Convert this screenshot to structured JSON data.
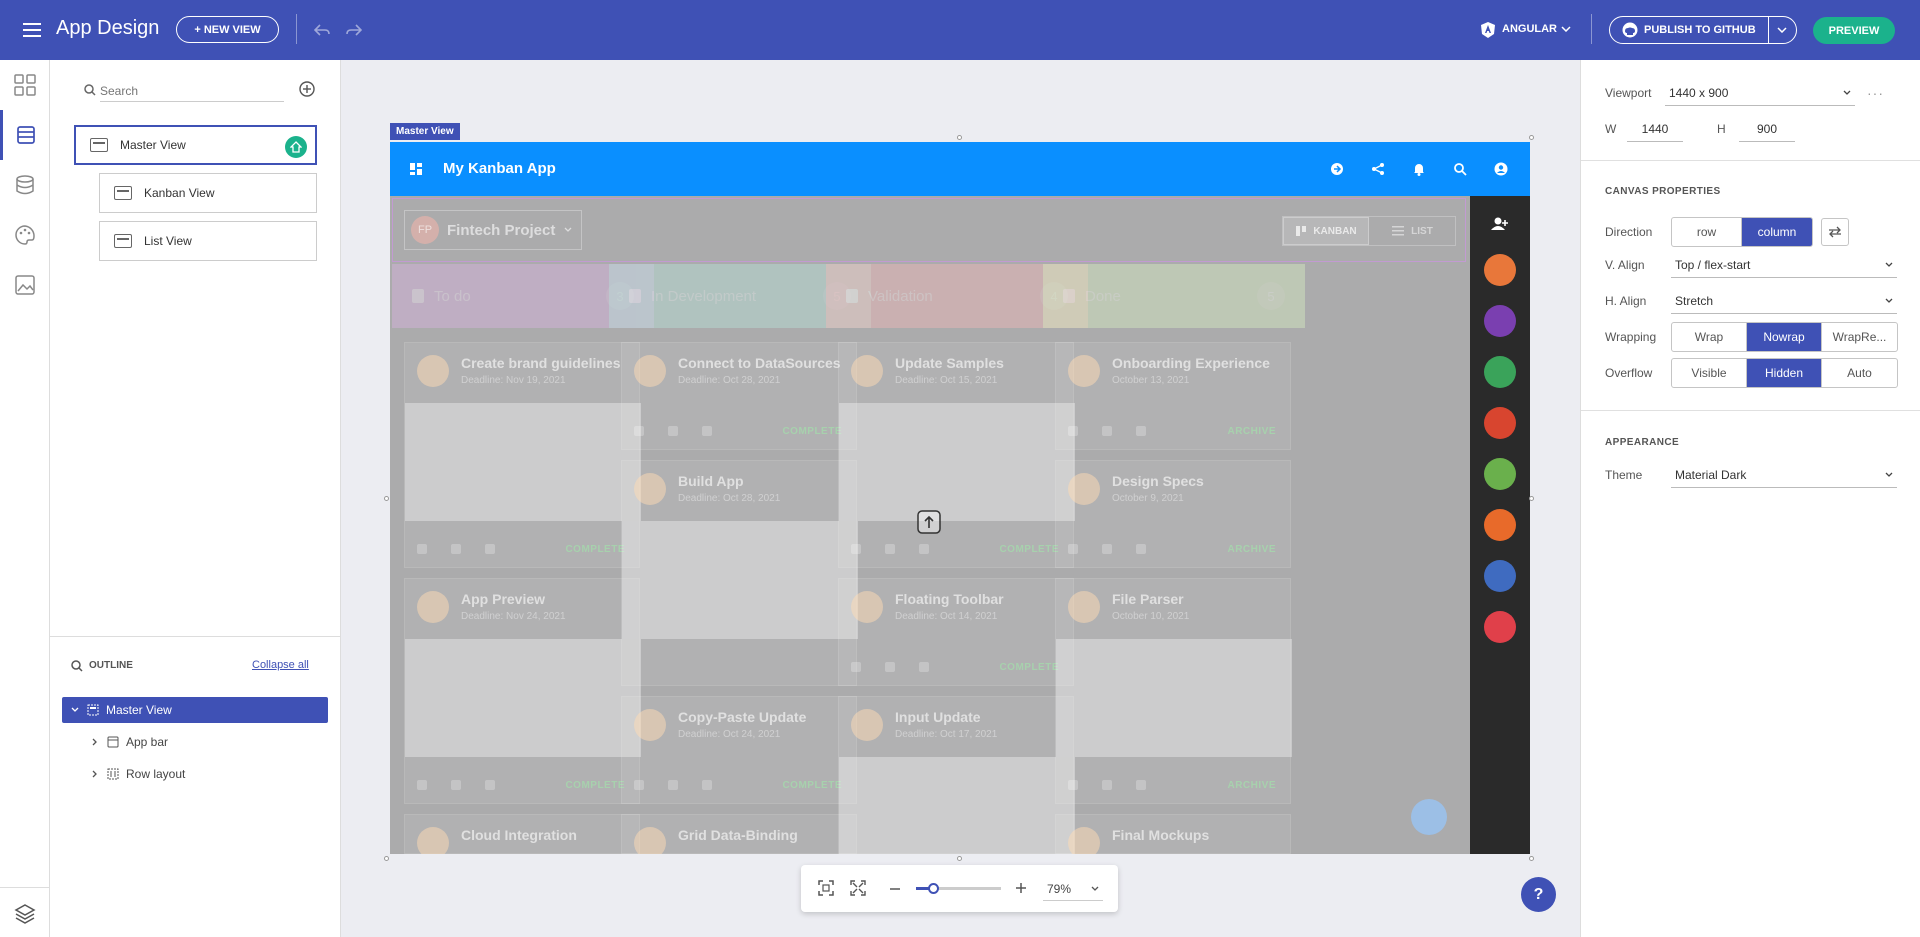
{
  "topbar": {
    "title": "App Design",
    "new_view": "+ NEW VIEW",
    "framework": "ANGULAR",
    "publish": "PUBLISH TO GITHUB",
    "preview": "PREVIEW",
    "colors": {
      "bar": "#3f51b5",
      "preview": "#1bb28c"
    }
  },
  "left": {
    "search_placeholder": "Search",
    "views": [
      {
        "label": "Master View"
      },
      {
        "label": "Kanban View"
      },
      {
        "label": "List View"
      }
    ],
    "outline": {
      "title": "OUTLINE",
      "collapse": "Collapse all",
      "items": [
        {
          "label": "Master View"
        },
        {
          "label": "App bar"
        },
        {
          "label": "Row layout"
        }
      ]
    }
  },
  "canvas": {
    "view_tag": "Master View",
    "zoom": "79%",
    "zoom_fraction": 0.2,
    "app": {
      "title": "My Kanban App",
      "project_initials": "FP",
      "project": "Fintech Project",
      "kanban": "KANBAN",
      "list": "LIST",
      "columns": [
        {
          "name": "To do",
          "count": "3",
          "color": "#d9b3e0",
          "cards": [
            {
              "title": "Create brand guidelines",
              "date": "Deadline: Nov 19, 2021",
              "status": "COMPLETE"
            },
            {
              "title": "App Preview",
              "date": "Deadline: Nov 24, 2021",
              "status": "COMPLETE"
            },
            {
              "title": "Cloud Integration",
              "date": "",
              "status": ""
            }
          ]
        },
        {
          "name": "In Development",
          "count": "5",
          "color": "#b7e0d8",
          "cards": [
            {
              "title": "Connect to DataSources",
              "date": "Deadline: Oct 28, 2021",
              "status": "COMPLETE"
            },
            {
              "title": "Build App",
              "date": "Deadline: Oct 28, 2021",
              "status": ""
            },
            {
              "title": "Copy-Paste Update",
              "date": "Deadline: Oct 24, 2021",
              "status": "COMPLETE"
            },
            {
              "title": "Grid Data-Binding",
              "date": "",
              "status": ""
            }
          ]
        },
        {
          "name": "Validation",
          "count": "4",
          "color": "#f0b8b8",
          "cards": [
            {
              "title": "Update Samples",
              "date": "Deadline: Oct 15, 2021",
              "status": "COMPLETE"
            },
            {
              "title": "Floating Toolbar",
              "date": "Deadline: Oct 14, 2021",
              "status": "COMPLETE"
            },
            {
              "title": "Input Update",
              "date": "Deadline: Oct 17, 2021",
              "status": ""
            }
          ]
        },
        {
          "name": "Done",
          "count": "5",
          "color": "#d7ecc0",
          "cards": [
            {
              "title": "Onboarding Experience",
              "date": "October 13, 2021",
              "status": "ARCHIVE"
            },
            {
              "title": "Design Specs",
              "date": "October 9, 2021",
              "status": "ARCHIVE"
            },
            {
              "title": "File Parser",
              "date": "October 10, 2021",
              "status": "ARCHIVE"
            },
            {
              "title": "Final Mockups",
              "date": "",
              "status": ""
            }
          ]
        }
      ]
    }
  },
  "right": {
    "viewport_label": "Viewport",
    "viewport": "1440 x 900",
    "w_label": "W",
    "w": "1440",
    "h_label": "H",
    "h": "900",
    "canvas_props": "CANVAS PROPERTIES",
    "direction_label": "Direction",
    "direction": [
      "row",
      "column"
    ],
    "valign_label": "V. Align",
    "valign": "Top / flex-start",
    "halign_label": "H. Align",
    "halign": "Stretch",
    "wrapping_label": "Wrapping",
    "wrapping": [
      "Wrap",
      "Nowrap",
      "WrapRe..."
    ],
    "overflow_label": "Overflow",
    "overflow": [
      "Visible",
      "Hidden",
      "Auto"
    ],
    "appearance": "APPEARANCE",
    "theme_label": "Theme",
    "theme": "Material Dark"
  }
}
